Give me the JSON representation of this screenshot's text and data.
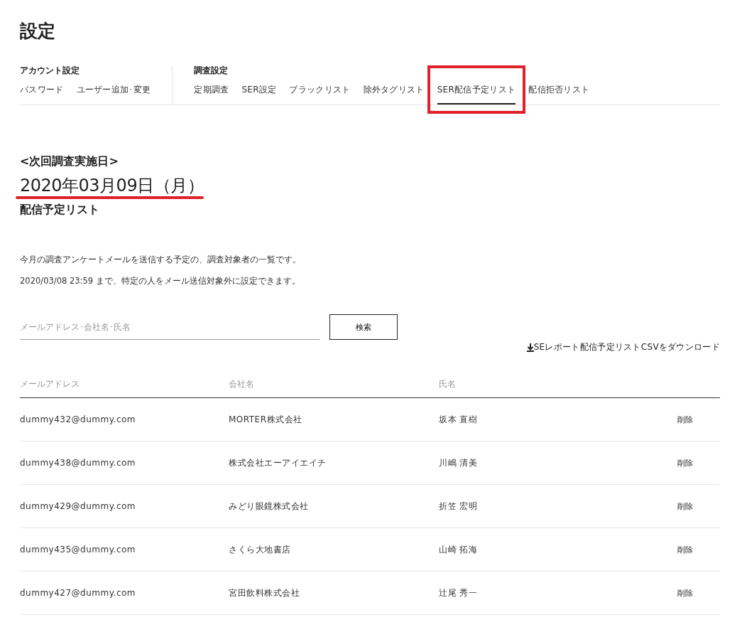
{
  "page_title": "設定",
  "nav_groups": [
    {
      "label": "アカウント設定",
      "items": [
        {
          "label": "パスワード",
          "selected": false
        },
        {
          "label": "ユーザー追加･変更",
          "selected": false
        }
      ]
    },
    {
      "label": "調査設定",
      "items": [
        {
          "label": "定期調査",
          "selected": false
        },
        {
          "label": "SER設定",
          "selected": false
        },
        {
          "label": "ブラックリスト",
          "selected": false
        },
        {
          "label": "除外タグリスト",
          "selected": false
        },
        {
          "label": "SER配信予定リスト",
          "selected": true
        },
        {
          "label": "配信拒否リスト",
          "selected": false
        }
      ]
    }
  ],
  "next_survey": {
    "label": "<次回調査実施日>",
    "date": "2020年03月09日（月）"
  },
  "section_title": "配信予定リスト",
  "description": [
    "今月の調査アンケートメールを送信する予定の、調査対象者の一覧です。",
    "2020/03/08 23:59 まで、特定の人をメール送信対象外に設定できます。"
  ],
  "search": {
    "placeholder": "メールアドレス･会社名･氏名",
    "button": "検索"
  },
  "download_link": "SEレポート配信予定リストCSVをダウンロード",
  "table": {
    "columns": [
      "メールアドレス",
      "会社名",
      "氏名"
    ],
    "rows": [
      {
        "email": "dummy432@dummy.com",
        "company": "MORTER株式会社",
        "name": "坂本 直樹",
        "action": "削除"
      },
      {
        "email": "dummy438@dummy.com",
        "company": "株式会社エーアイエイチ",
        "name": "川嶋 清美",
        "action": "削除"
      },
      {
        "email": "dummy429@dummy.com",
        "company": "みどり眼鏡株式会社",
        "name": "折笠 宏明",
        "action": "削除"
      },
      {
        "email": "dummy435@dummy.com",
        "company": "さくら大地書店",
        "name": "山崎 拓海",
        "action": "削除"
      },
      {
        "email": "dummy427@dummy.com",
        "company": "宮田飲料株式会社",
        "name": "辻尾 秀一",
        "action": "削除"
      }
    ]
  }
}
